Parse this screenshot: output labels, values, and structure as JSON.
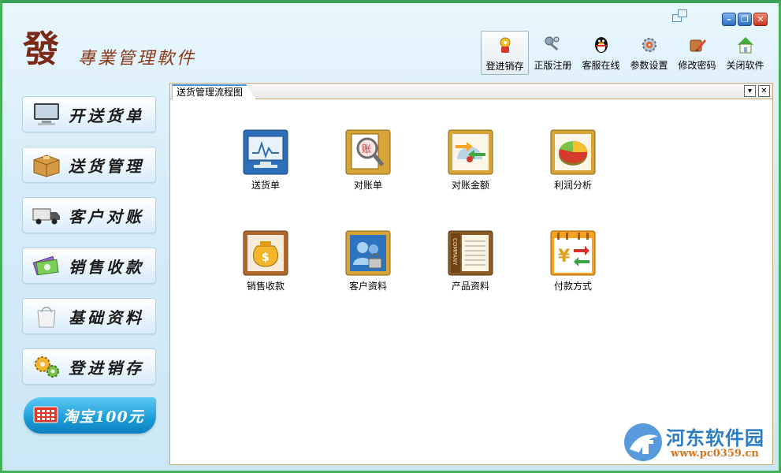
{
  "app": {
    "logo_glyph": "發",
    "logo_text": "專業管理軟件"
  },
  "window_controls": {
    "minimize": "–",
    "restore": "❐",
    "close": "✕"
  },
  "toolbar": {
    "items": [
      {
        "label": "登进销存",
        "icon": "stock-icon"
      },
      {
        "label": "正版注册",
        "icon": "keys-icon"
      },
      {
        "label": "客服在线",
        "icon": "qq-penguin-icon"
      },
      {
        "label": "参数设置",
        "icon": "settings-icon"
      },
      {
        "label": "修改密码",
        "icon": "pencil-password-icon"
      },
      {
        "label": "关闭软件",
        "icon": "exit-home-icon"
      }
    ]
  },
  "sidebar": {
    "items": [
      {
        "label": "开送货单",
        "icon": "monitor-icon"
      },
      {
        "label": "送货管理",
        "icon": "box-icon"
      },
      {
        "label": "客户对账",
        "icon": "truck-icon"
      },
      {
        "label": "销售收款",
        "icon": "money-icon"
      },
      {
        "label": "基础资料",
        "icon": "bag-icon"
      },
      {
        "label": "登进销存",
        "icon": "gears-icon"
      }
    ],
    "promo_label": "淘宝100元"
  },
  "panel": {
    "tab_label": "送货管理流程图",
    "tab_dropdown": "▾",
    "tab_close": "✕",
    "cards": [
      {
        "label": "送货单",
        "icon": "delivery-note-icon"
      },
      {
        "label": "对账单",
        "icon": "statement-icon"
      },
      {
        "label": "对账金额",
        "icon": "statement-amount-icon"
      },
      {
        "label": "利润分析",
        "icon": "pie-chart-icon"
      },
      {
        "label": "销售收款",
        "icon": "money-bag-icon"
      },
      {
        "label": "客户资料",
        "icon": "customer-icon"
      },
      {
        "label": "产品资料",
        "icon": "product-doc-icon"
      },
      {
        "label": "付款方式",
        "icon": "payment-icon"
      }
    ]
  },
  "watermark": {
    "title": "河东软件园",
    "url": "www.pc0359.cn"
  }
}
